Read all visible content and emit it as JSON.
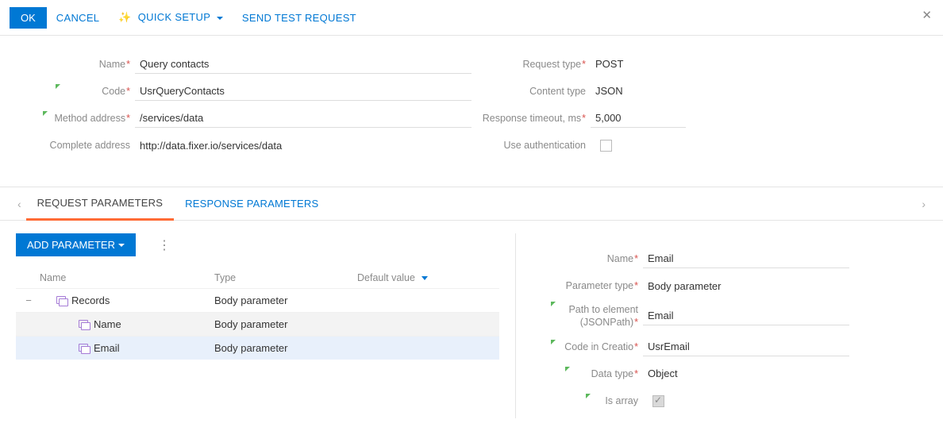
{
  "toolbar": {
    "ok": "OK",
    "cancel": "CANCEL",
    "quick_setup": "QUICK SETUP",
    "send_test": "SEND TEST REQUEST"
  },
  "form": {
    "left": {
      "name_label": "Name",
      "name_value": "Query contacts",
      "code_label": "Code",
      "code_value": "UsrQueryContacts",
      "method_label": "Method address",
      "method_value": "/services/data",
      "complete_label": "Complete address",
      "complete_value": "http://data.fixer.io/services/data"
    },
    "right": {
      "reqtype_label": "Request type",
      "reqtype_value": "POST",
      "contenttype_label": "Content type",
      "contenttype_value": "JSON",
      "timeout_label": "Response timeout, ms",
      "timeout_value": "5,000",
      "auth_label": "Use authentication"
    }
  },
  "tabs": {
    "request": "REQUEST PARAMETERS",
    "response": "RESPONSE PARAMETERS"
  },
  "params": {
    "add_btn": "ADD PARAMETER",
    "columns": {
      "name": "Name",
      "type": "Type",
      "default": "Default value"
    },
    "rows": [
      {
        "name": "Records",
        "type": "Body parameter",
        "level": 1,
        "expanded": true
      },
      {
        "name": "Name",
        "type": "Body parameter",
        "level": 2
      },
      {
        "name": "Email",
        "type": "Body parameter",
        "level": 2,
        "selected": true
      }
    ]
  },
  "detail": {
    "name_label": "Name",
    "name_value": "Email",
    "paramtype_label": "Parameter type",
    "paramtype_value": "Body parameter",
    "path_label": "Path to element (JSONPath)",
    "path_value": "Email",
    "code_label": "Code in Creatio",
    "code_value": "UsrEmail",
    "datatype_label": "Data type",
    "datatype_value": "Object",
    "isarray_label": "Is array"
  }
}
